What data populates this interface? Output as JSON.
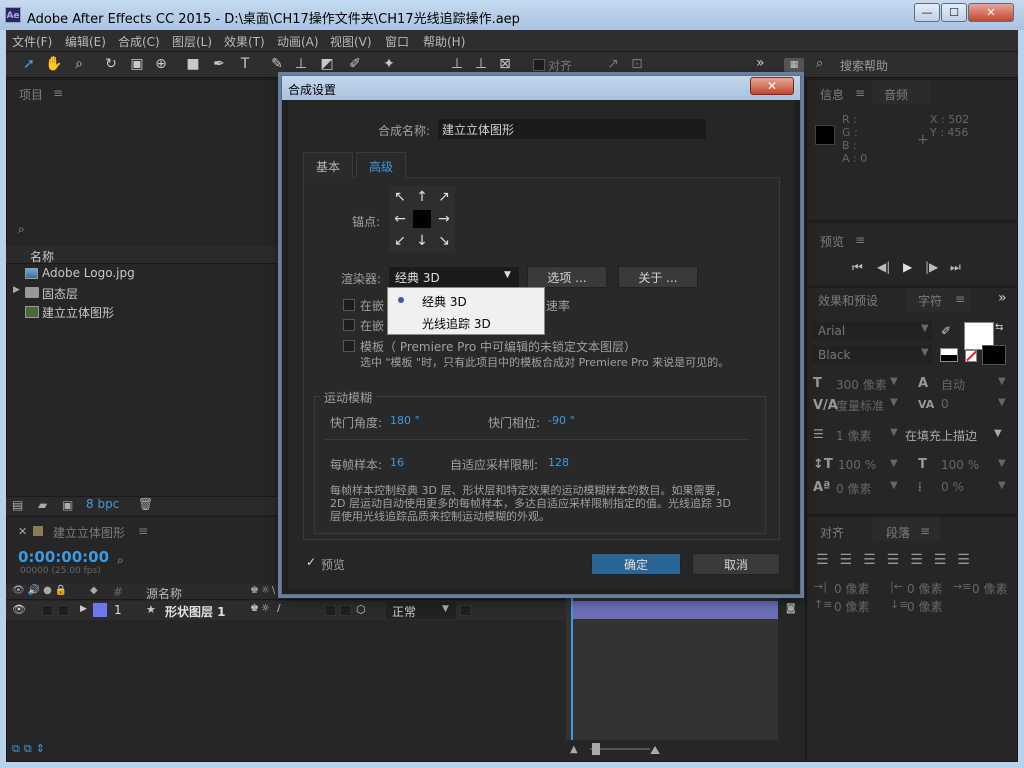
{
  "window": {
    "title": "Adobe After Effects CC 2015 - D:\\桌面\\CH17操作文件夹\\CH17光线追踪操作.aep",
    "min": "—",
    "max": "☐",
    "close": "✕"
  },
  "menu": [
    "文件(F)",
    "编辑(E)",
    "合成(C)",
    "图层(L)",
    "效果(T)",
    "动画(A)",
    "视图(V)",
    "窗口",
    "帮助(H)"
  ],
  "toolbar": {
    "align_label": "对齐",
    "more": "»",
    "search_help": "搜索帮助"
  },
  "project": {
    "title": "项目",
    "search_icon": "⌕",
    "name_col": "名称",
    "items": [
      {
        "label": "Adobe Logo.jpg"
      },
      {
        "label": "固态层"
      },
      {
        "label": "建立立体图形"
      }
    ],
    "bpc": "8 bpc"
  },
  "info": {
    "tab1": "信息",
    "tab2": "音频",
    "r": "R :",
    "g": "G :",
    "b": "B :",
    "a": "A : 0",
    "x": "X : 502",
    "y": "Y : 456"
  },
  "preview": {
    "title": "预览",
    "controls": [
      "⏮",
      "◀|",
      "▶",
      "|▶",
      "⏭"
    ]
  },
  "effects": {
    "tab1": "效果和预设",
    "tab2": "字符"
  },
  "character": {
    "font": "Arial",
    "style": "Black",
    "size": "300 像素",
    "leading": "自动",
    "kerning": "度量标准",
    "tracking": "0",
    "stroke_width": "1 像素",
    "stroke_mode": "在填充上描边",
    "vscale": "100 %",
    "hscale": "100 %",
    "baseline": "0 像素",
    "tsume": "0 %"
  },
  "paragraph": {
    "tab1": "对齐",
    "tab2": "段落",
    "indent1": "0 像素",
    "indent2": "0 像素",
    "indent3": "0 像素",
    "space1": "0 像素",
    "space2": "0 像素"
  },
  "timeline": {
    "comp_tab": "建立立体图形",
    "timecode": "0:00:00:00",
    "fps": "00000 (25.00 fps)",
    "col_hash": "#",
    "col_source": "源名称",
    "layer": {
      "num": "1",
      "name": "形状图层 1",
      "mode": "正常"
    }
  },
  "dialog": {
    "title": "合成设置",
    "close": "✕",
    "comp_name_label": "合成名称:",
    "comp_name": "建立立体图形",
    "tab_basic": "基本",
    "tab_advanced": "高级",
    "anchor_label": "锚点:",
    "renderer_label": "渲染器:",
    "renderer_value": "经典 3D",
    "options_btn": "选项 ...",
    "about_btn": "关于 ...",
    "check1": "在嵌",
    "check1_tail": "速率",
    "check2": "在嵌",
    "template_label": "模板（ Premiere Pro 中可编辑的未锁定文本图层）",
    "template_desc": "选中 \"模板 \"时，只有此项目中的模板合成对 Premiere Pro 来说是可见的。",
    "motion_blur": "运动模糊",
    "shutter_angle_label": "快门角度:",
    "shutter_angle": "180 °",
    "shutter_phase_label": "快门相位:",
    "shutter_phase": "-90 °",
    "samples_label": "每帧样本:",
    "samples": "16",
    "adaptive_label": "自适应采样限制:",
    "adaptive": "128",
    "desc": "每帧样本控制经典 3D 层、形状层和特定效果的运动模糊样本的数目。如果需要，2D 层运动自动使用更多的每帧样本，多达自适应采样限制指定的值。光线追踪 3D 层使用光线追踪品质来控制运动模糊的外观。",
    "preview_label": "预览",
    "ok": "确定",
    "cancel": "取消",
    "dropdown": [
      "经典 3D",
      "光线追踪 3D"
    ]
  }
}
